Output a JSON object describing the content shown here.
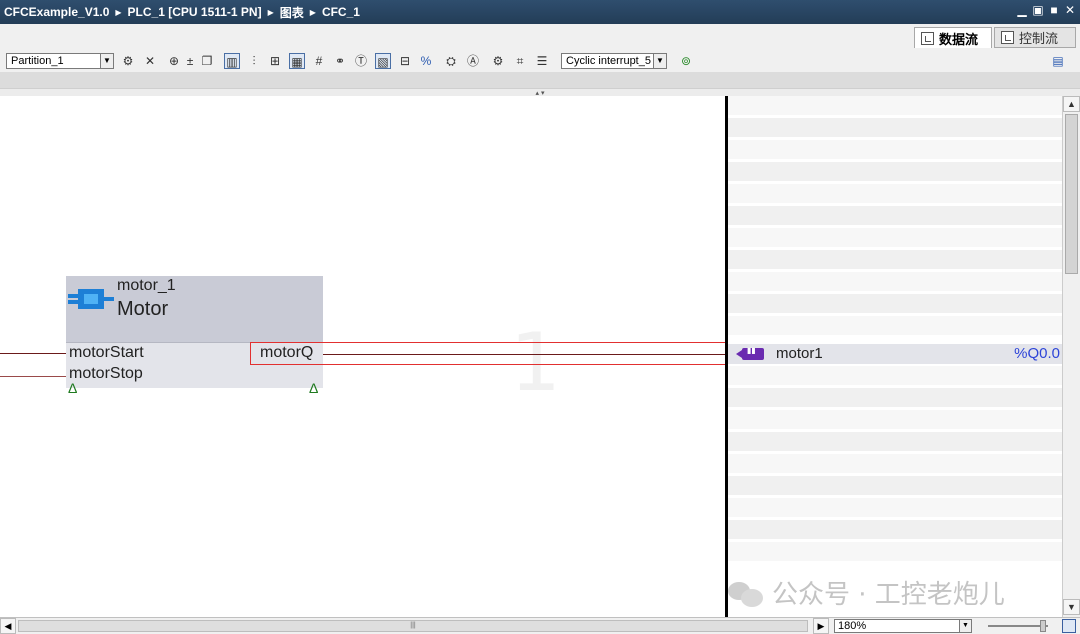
{
  "title_bar": {
    "breadcrumb": [
      "CFCExample_V1.0",
      "PLC_1 [CPU 1511-1 PN]",
      "图表",
      "CFC_1"
    ]
  },
  "tabs": {
    "active": "数据流",
    "inactive": "控制流"
  },
  "toolbar": {
    "partition_value": "Partition_1",
    "task_value": "Cyclic interrupt_5"
  },
  "canvas": {
    "sheet_number": "1",
    "block": {
      "instance_name": "motor_1",
      "type_name": "Motor",
      "inputs": [
        "motorStart",
        "motorStop"
      ],
      "output": "motorQ"
    }
  },
  "sidebar": {
    "tag_name": "motor1",
    "tag_address": "%Q0.0"
  },
  "bottom": {
    "zoom_value": "180%"
  },
  "watermark": {
    "text": "公众号 · 工控老炮儿"
  },
  "colors": {
    "highlight": "#e23030",
    "wire": "#6b1a1a",
    "address": "#2d44d8"
  }
}
